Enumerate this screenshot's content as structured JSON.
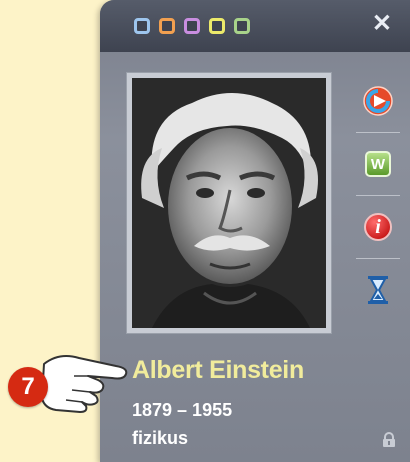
{
  "window": {
    "color_dots": [
      "#9ec6ee",
      "#f2a050",
      "#c98ee0",
      "#ecea6a",
      "#a8d38a"
    ],
    "close_glyph": "✕"
  },
  "person": {
    "name": "Albert Einstein",
    "years": "1879 – 1955",
    "profession": "fizikus"
  },
  "sidebar": {
    "buttons": [
      {
        "icon": "play-back-icon"
      },
      {
        "icon": "wikipedia-icon",
        "label": "W"
      },
      {
        "icon": "info-icon",
        "label": "i"
      },
      {
        "icon": "hourglass-icon"
      }
    ]
  },
  "callout": {
    "number": "7"
  },
  "colors": {
    "accent_name": "#f1ec9c",
    "background": "#fdf3c8",
    "panel": "#8b909c",
    "callout_badge": "#d52a12"
  }
}
